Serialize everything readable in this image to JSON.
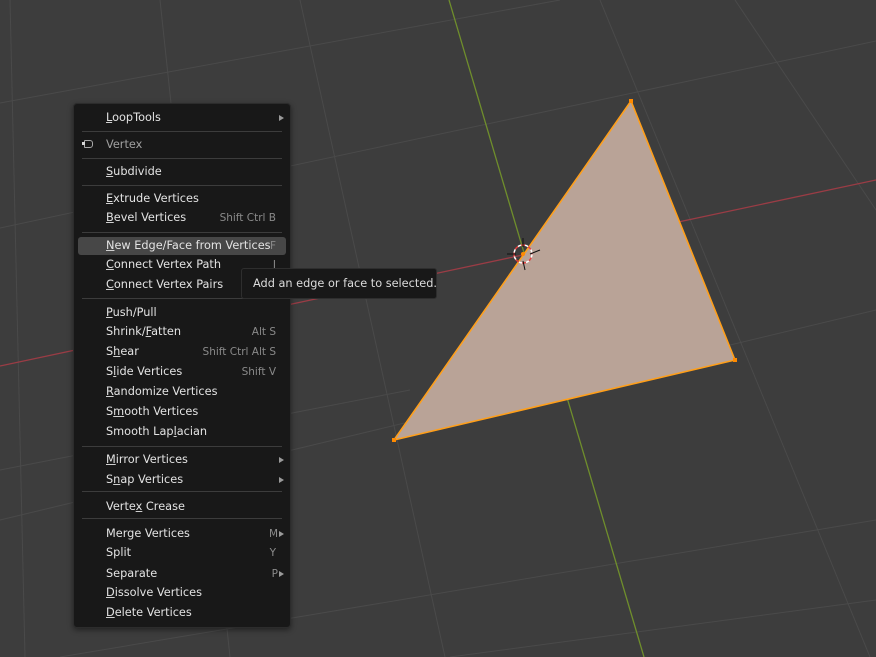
{
  "menu": {
    "items": [
      {
        "kind": "item",
        "label": "LoopTools",
        "ul": 0,
        "submenu": true
      },
      {
        "kind": "sep"
      },
      {
        "kind": "header",
        "label": "Vertex"
      },
      {
        "kind": "sep"
      },
      {
        "kind": "item",
        "label": "Subdivide",
        "ul": 0
      },
      {
        "kind": "sep"
      },
      {
        "kind": "item",
        "label": "Extrude Vertices",
        "ul": 0
      },
      {
        "kind": "item",
        "label": "Bevel Vertices",
        "ul": 0,
        "shortcut": "Shift Ctrl B"
      },
      {
        "kind": "sep"
      },
      {
        "kind": "item",
        "label": "New Edge/Face from Vertices",
        "ul": 0,
        "shortcut": "F",
        "highlighted": true
      },
      {
        "kind": "item",
        "label": "Connect Vertex Path",
        "ul": 0,
        "shortcut": "J"
      },
      {
        "kind": "item",
        "label": "Connect Vertex Pairs",
        "ul": 0
      },
      {
        "kind": "sep"
      },
      {
        "kind": "item",
        "label": "Push/Pull",
        "ul": 0
      },
      {
        "kind": "item",
        "label": "Shrink/Fatten",
        "ul": 7,
        "shortcut": "Alt S"
      },
      {
        "kind": "item",
        "label": "Shear",
        "ul": 1,
        "shortcut": "Shift Ctrl Alt S"
      },
      {
        "kind": "item",
        "label": "Slide Vertices",
        "ul": 1,
        "shortcut": "Shift V"
      },
      {
        "kind": "item",
        "label": "Randomize Vertices",
        "ul": 0
      },
      {
        "kind": "item",
        "label": "Smooth Vertices",
        "ul": 1
      },
      {
        "kind": "item",
        "label": "Smooth Laplacian",
        "ul": 10
      },
      {
        "kind": "sep"
      },
      {
        "kind": "item",
        "label": "Mirror Vertices",
        "ul": 0,
        "submenu": true
      },
      {
        "kind": "item",
        "label": "Snap Vertices",
        "ul": 1,
        "submenu": true
      },
      {
        "kind": "sep"
      },
      {
        "kind": "item",
        "label": "Vertex Crease",
        "ul": 5
      },
      {
        "kind": "sep"
      },
      {
        "kind": "item",
        "label": "Merge Vertices",
        "ul": -1,
        "shortcut": "M",
        "submenu": true
      },
      {
        "kind": "item",
        "label": "Split",
        "ul": -1,
        "shortcut": "Y"
      },
      {
        "kind": "item",
        "label": "Separate",
        "ul": -1,
        "shortcut": "P",
        "submenu": true
      },
      {
        "kind": "item",
        "label": "Dissolve Vertices",
        "ul": 0
      },
      {
        "kind": "item",
        "label": "Delete Vertices",
        "ul": 0
      }
    ]
  },
  "tooltip": {
    "text": "Add an edge or face to selected."
  },
  "colors": {
    "background": "#3d3d3d",
    "grid": "#4a4a4a",
    "x_axis": "#9a3c45",
    "y_axis": "#6f8e2c",
    "face_fill": "#b9a397",
    "edge_select": "#ff9f1a",
    "vertex_select": "#ff8a00",
    "menu_bg": "#181818",
    "menu_highlight": "#474747"
  }
}
